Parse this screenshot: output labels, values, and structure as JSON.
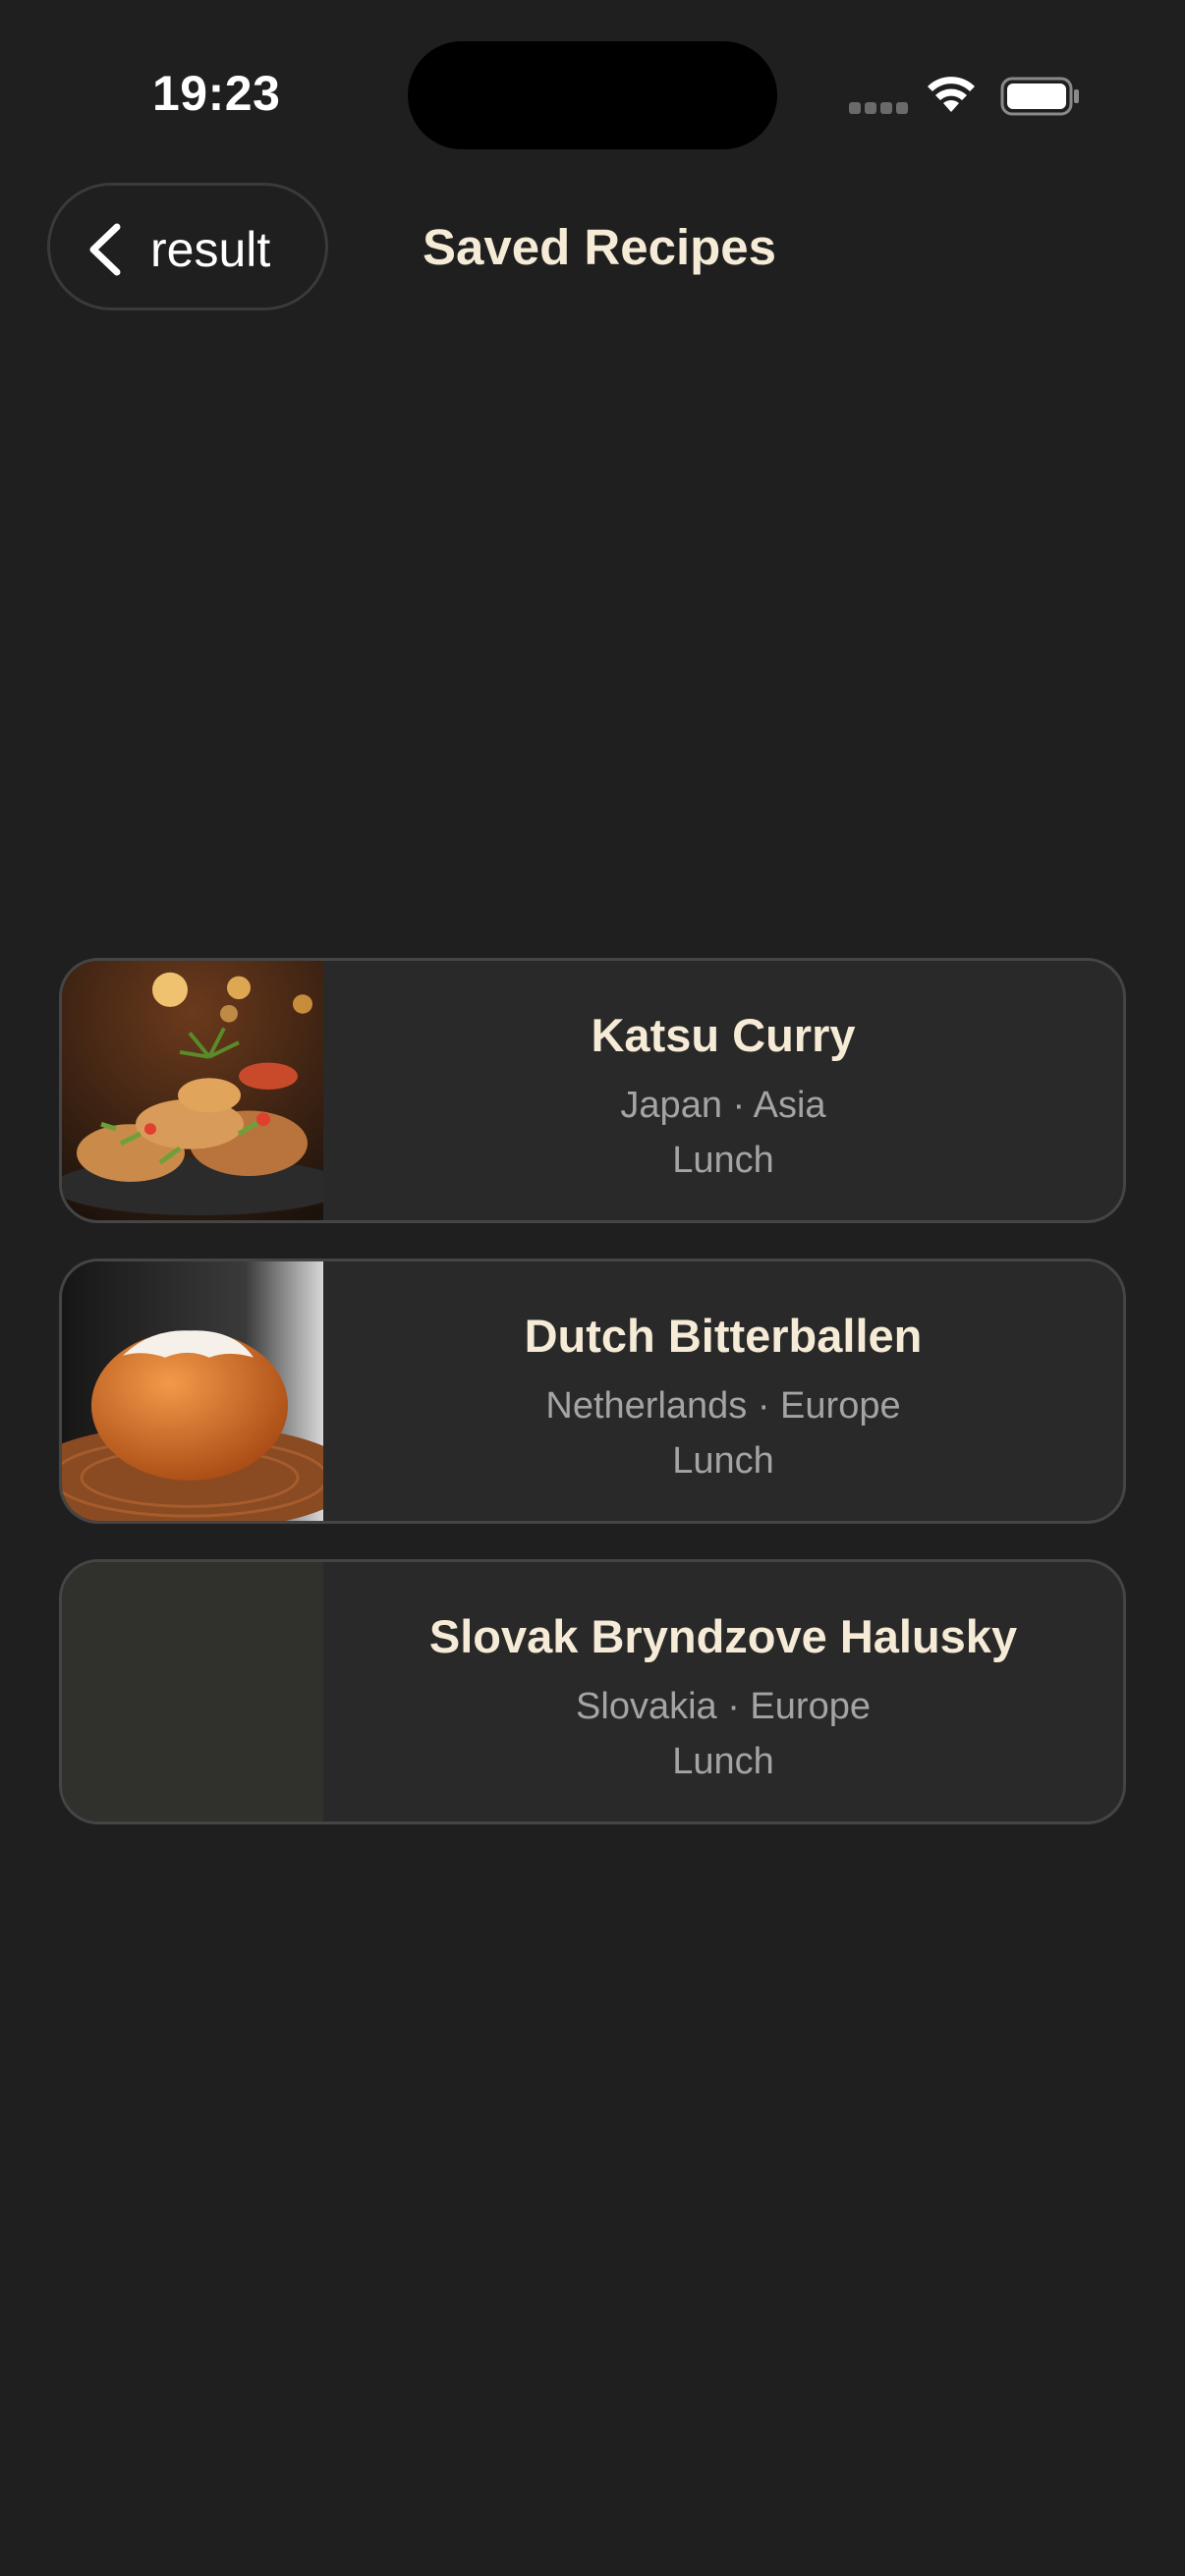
{
  "status_bar": {
    "time": "19:23",
    "icons": [
      "signal-icon",
      "wifi-icon",
      "battery-icon"
    ]
  },
  "header": {
    "back_label": "result",
    "title": "Saved Recipes"
  },
  "recipes": [
    {
      "title": "Katsu Curry",
      "meta": "Japan · Asia",
      "meal": "Lunch",
      "image": "fried-food-photo"
    },
    {
      "title": "Dutch Bitterballen",
      "meta": "Netherlands · Europe",
      "meal": "Lunch",
      "image": "bitterball-photo"
    },
    {
      "title": "Slovak Bryndzove Halusky",
      "meta": "Slovakia · Europe",
      "meal": "Lunch",
      "image": "placeholder"
    }
  ],
  "colors": {
    "background": "#1f1f1f",
    "card": "#292929",
    "title": "#f5ebd6",
    "meta": "#a4a4a4"
  }
}
